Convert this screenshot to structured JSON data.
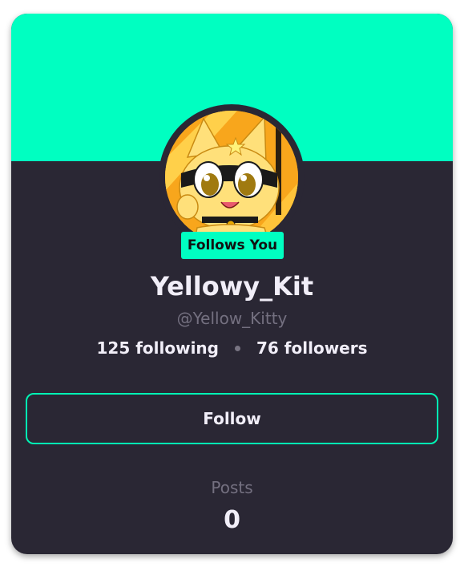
{
  "profile": {
    "banner_color": "#00ffc1",
    "avatar": "yellow-cat-avatar",
    "follows_badge": "Follows You",
    "display_name": "Yellowy_Kit",
    "handle": "@Yellow_Kitty",
    "following_text": "125 following",
    "followers_text": "76 followers",
    "follow_label": "Follow",
    "posts_label": "Posts",
    "posts_count": "0"
  },
  "colors": {
    "accent": "#00ffc1",
    "card_background": "#2a2734",
    "text_primary": "#f1eef8",
    "text_muted": "#747080"
  }
}
